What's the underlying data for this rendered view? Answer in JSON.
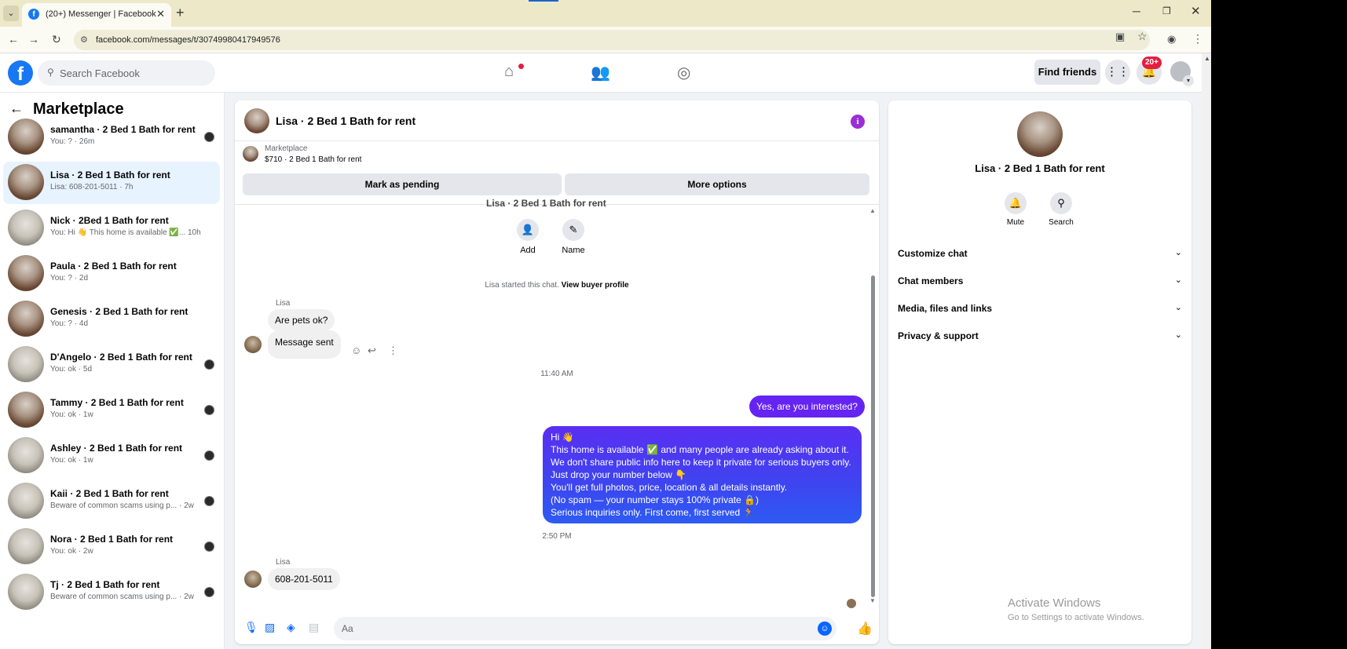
{
  "browser": {
    "tab_title": "(20+) Messenger | Facebook",
    "url": "facebook.com/messages/t/30749980417949576"
  },
  "fb": {
    "search_placeholder": "Search Facebook",
    "find_friends": "Find friends",
    "notif_count": "20+"
  },
  "sidebar": {
    "title": "Marketplace",
    "conversations": [
      {
        "name": "samantha · 2 Bed 1 Bath for rent",
        "snippet": "You: ? · 26m",
        "thumb": "a",
        "avatar": true
      },
      {
        "name": "Lisa · 2 Bed 1 Bath for rent",
        "snippet": "Lisa: 608-201-5011 · 7h",
        "thumb": "a",
        "avatar": false,
        "active": true
      },
      {
        "name": "Nick · 2Bed 1 Bath for rent",
        "snippet": "You: Hi 👋 This home is available ✅... 10h",
        "thumb": "b",
        "avatar": false
      },
      {
        "name": "Paula · 2 Bed 1 Bath for rent",
        "snippet": "You: ? · 2d",
        "thumb": "a",
        "avatar": false
      },
      {
        "name": "Genesis · 2 Bed 1 Bath for rent",
        "snippet": "You: ? · 4d",
        "thumb": "a",
        "avatar": false
      },
      {
        "name": "D'Angelo · 2 Bed 1 Bath for rent",
        "snippet": "You: ok · 5d",
        "thumb": "b",
        "avatar": true
      },
      {
        "name": "Tammy · 2 Bed 1 Bath for rent",
        "snippet": "You: ok · 1w",
        "thumb": "a",
        "avatar": true
      },
      {
        "name": "Ashley · 2 Bed 1 Bath for rent",
        "snippet": "You: ok · 1w",
        "thumb": "b",
        "avatar": true
      },
      {
        "name": "Kaii · 2 Bed 1 Bath for rent",
        "snippet": "Beware of common scams using p... · 2w",
        "thumb": "b",
        "avatar": true
      },
      {
        "name": "Nora · 2 Bed 1 Bath for rent",
        "snippet": "You: ok · 2w",
        "thumb": "b",
        "avatar": true
      },
      {
        "name": "Tj · 2 Bed 1 Bath for rent",
        "snippet": "Beware of common scams using p... · 2w",
        "thumb": "b",
        "avatar": true
      }
    ]
  },
  "chat": {
    "title": "Lisa · 2 Bed 1 Bath for rent",
    "listing": {
      "source": "Marketplace",
      "price_title": "$710 · 2 Bed 1 Bath for rent"
    },
    "mark_pending": "Mark as pending",
    "more_options": "More options",
    "cut_title": "Lisa · 2 Bed 1 Bath for rent",
    "add_label": "Add",
    "name_label": "Name",
    "started_text": "Lisa started this chat. ",
    "started_link": "View buyer profile",
    "sender_1": "Lisa",
    "msg_pets": "Are pets ok?",
    "msg_sent": "Message sent",
    "time_1": "11:40 AM",
    "msg_interested": "Yes, are you interested?",
    "long_msg": [
      "Hi 👋",
      "This home is available ✅ and many people are already asking about it.",
      "We don't share public info here to keep it private for serious buyers only.",
      "Just drop your number below 👇",
      "You'll get full photos, price, location & all details instantly.",
      "(No spam — your number stays 100% private 🔒)",
      "Serious inquiries only. First come, first served 🏃"
    ],
    "time_2": "2:50 PM",
    "sender_2": "Lisa",
    "msg_phone": "608-201-5011",
    "composer_placeholder": "Aa"
  },
  "info_panel": {
    "name": "Lisa · 2 Bed 1 Bath for rent",
    "mute": "Mute",
    "search": "Search",
    "sections": [
      "Customize chat",
      "Chat members",
      "Media, files and links",
      "Privacy & support"
    ],
    "activate_title": "Activate Windows",
    "activate_sub": "Go to Settings to activate Windows."
  },
  "colors": {
    "accent": "#0866ff",
    "outgoing_bubble": "#6524f2",
    "active_conversation": "#e7f3ff"
  }
}
